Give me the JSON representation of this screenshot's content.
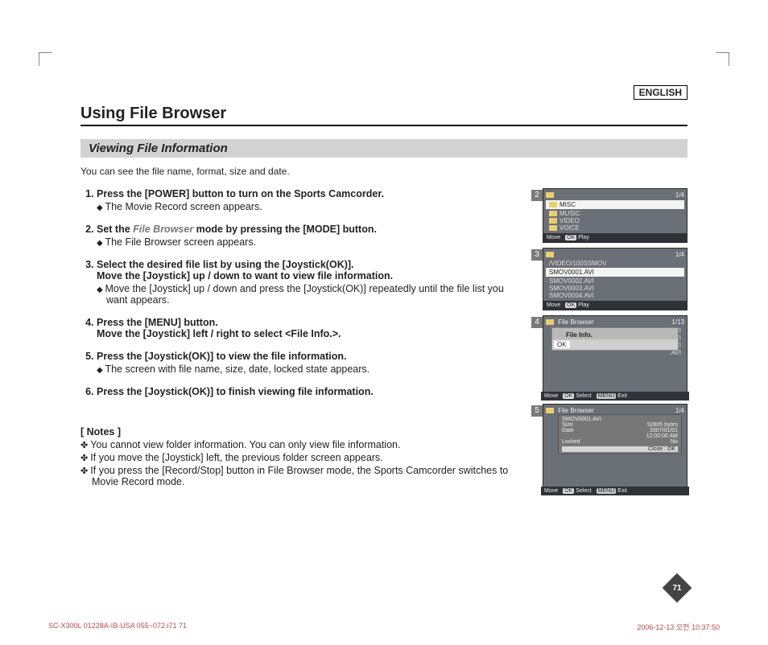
{
  "lang_tag": "ENGLISH",
  "title": "Using File Browser",
  "subtitle": "Viewing File Information",
  "intro": "You can see the file name, format, size and date.",
  "steps": {
    "s1": {
      "head": "Press the [POWER] button to turn on the Sports Camcorder.",
      "sub1": "The Movie Record screen appears."
    },
    "s2": {
      "head_a": "Set the ",
      "head_em": "File Browser",
      "head_b": " mode by pressing the [MODE] button.",
      "sub1": "The File Browser screen appears."
    },
    "s3": {
      "head_a": "Select the desired file list by using the [Joystick(OK)].",
      "head_b": "Move the [Joystick] up / down to want to view file information.",
      "sub1": "Move the [Joystick] up / down and press the [Joystick(OK)] repeatedly until the file list you want appears."
    },
    "s4": {
      "head_a": "Press the [MENU] button.",
      "head_b": "Move the [Joystick] left / right to select <File Info.>."
    },
    "s5": {
      "head": "Press the [Joystick(OK)] to view the file information.",
      "sub1": "The screen with file name, size, date, locked state appears."
    },
    "s6": {
      "head": "Press the [Joystick(OK)] to finish viewing file information."
    }
  },
  "notes_head": "[ Notes ]",
  "notes": {
    "n1": "You cannot view folder information. You can only view file information.",
    "n2": "If you move the [Joystick] left, the previous folder screen appears.",
    "n3": "If you press the [Record/Stop] button in File Browser mode, the Sports Camcorder switches to Movie Record mode."
  },
  "shots": {
    "b2": "2",
    "b3": "3",
    "b4": "4",
    "b5": "5",
    "count14": "1/4",
    "count113": "1/13",
    "folders": {
      "f1": "MISC",
      "f2": "MUSIC",
      "f3": "VIDEO",
      "f4": "VOICE"
    },
    "path3": "/VIDEO/100SSMOV",
    "files": {
      "a1": "SMOV0001.AVI",
      "a2": "SMOV0002.AVI",
      "a3": "SMOV0003.AVI",
      "a4": "SMOV0004.AVI"
    },
    "foot_move": "Move",
    "foot_play": "Play",
    "foot_select": "Select",
    "foot_exit": "Exit",
    "ok": "OK",
    "menu": "MENU",
    "fb_label": "File Browser",
    "popup_title": "File Info.",
    "ext": ".AVI",
    "info": {
      "name": "SMOV0001.AVI",
      "size_l": "Size",
      "size_v": "52805 bytes",
      "date_l": "Date",
      "date_v": "2007/01/01",
      "time_v": "12:00:00 AM",
      "lock_l": "Locked",
      "lock_v": "No",
      "close": "Close : OK"
    }
  },
  "page_num": "71",
  "footer_left": "SC-X300L 01228A-IB-USA 055~072.i71   71",
  "footer_right": "2006-12-13   오전 10:37:50"
}
